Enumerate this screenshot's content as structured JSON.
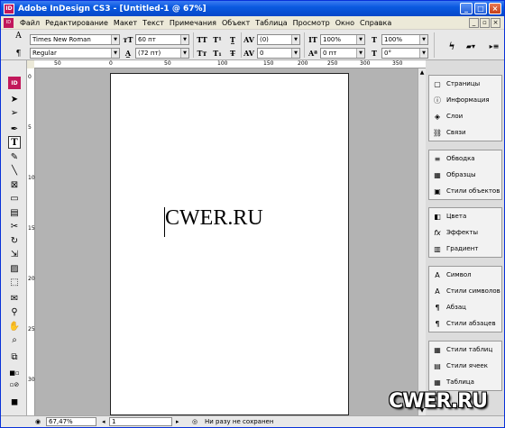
{
  "window": {
    "title": "Adobe InDesign CS3 - [Untitled-1 @ 67%]",
    "app_badge": "ID"
  },
  "menu": [
    "Файл",
    "Редактирование",
    "Макет",
    "Текст",
    "Примечания",
    "Объект",
    "Таблица",
    "Просмотр",
    "Окно",
    "Справка"
  ],
  "control": {
    "font_family": "Times New Roman",
    "font_style": "Regular",
    "font_size": "60 пт",
    "leading": "(72 пт)",
    "kerning": "(0)",
    "tracking": "0",
    "vscale": "100%",
    "hscale": "100%",
    "baseline": "0 пт",
    "skew": "0°"
  },
  "ruler_h": [
    "50",
    "0",
    "50",
    "100",
    "150",
    "200",
    "250",
    "300",
    "350"
  ],
  "ruler_v": [
    "0",
    "5",
    "10",
    "15",
    "20",
    "25",
    "30"
  ],
  "document": {
    "frame_text": "CWER.RU"
  },
  "panels": {
    "group1": [
      {
        "icon": "pages-icon",
        "label": "Страницы"
      },
      {
        "icon": "info-icon",
        "label": "Информация"
      },
      {
        "icon": "layers-icon",
        "label": "Слои"
      },
      {
        "icon": "links-icon",
        "label": "Связи"
      }
    ],
    "group2": [
      {
        "icon": "stroke-icon",
        "label": "Обводка"
      },
      {
        "icon": "swatches-icon",
        "label": "Образцы"
      },
      {
        "icon": "object-styles-icon",
        "label": "Стили объектов"
      }
    ],
    "group3": [
      {
        "icon": "color-icon",
        "label": "Цвета"
      },
      {
        "icon": "effects-icon",
        "label": "Эффекты"
      },
      {
        "icon": "gradient-icon",
        "label": "Градиент"
      }
    ],
    "group4": [
      {
        "icon": "glyphs-icon",
        "label": "Символ"
      },
      {
        "icon": "character-styles-icon",
        "label": "Стили символов"
      },
      {
        "icon": "paragraph-icon",
        "label": "Абзац"
      },
      {
        "icon": "paragraph-styles-icon",
        "label": "Стили абзацев"
      }
    ],
    "group5": [
      {
        "icon": "table-styles-icon",
        "label": "Стили таблиц"
      },
      {
        "icon": "cell-styles-icon",
        "label": "Стили ячеек"
      },
      {
        "icon": "table-icon",
        "label": "Таблица"
      }
    ]
  },
  "status": {
    "zoom": "67,47%",
    "page": "1",
    "save_state": "Ни разу не сохранен"
  },
  "watermark": "CWER.RU"
}
